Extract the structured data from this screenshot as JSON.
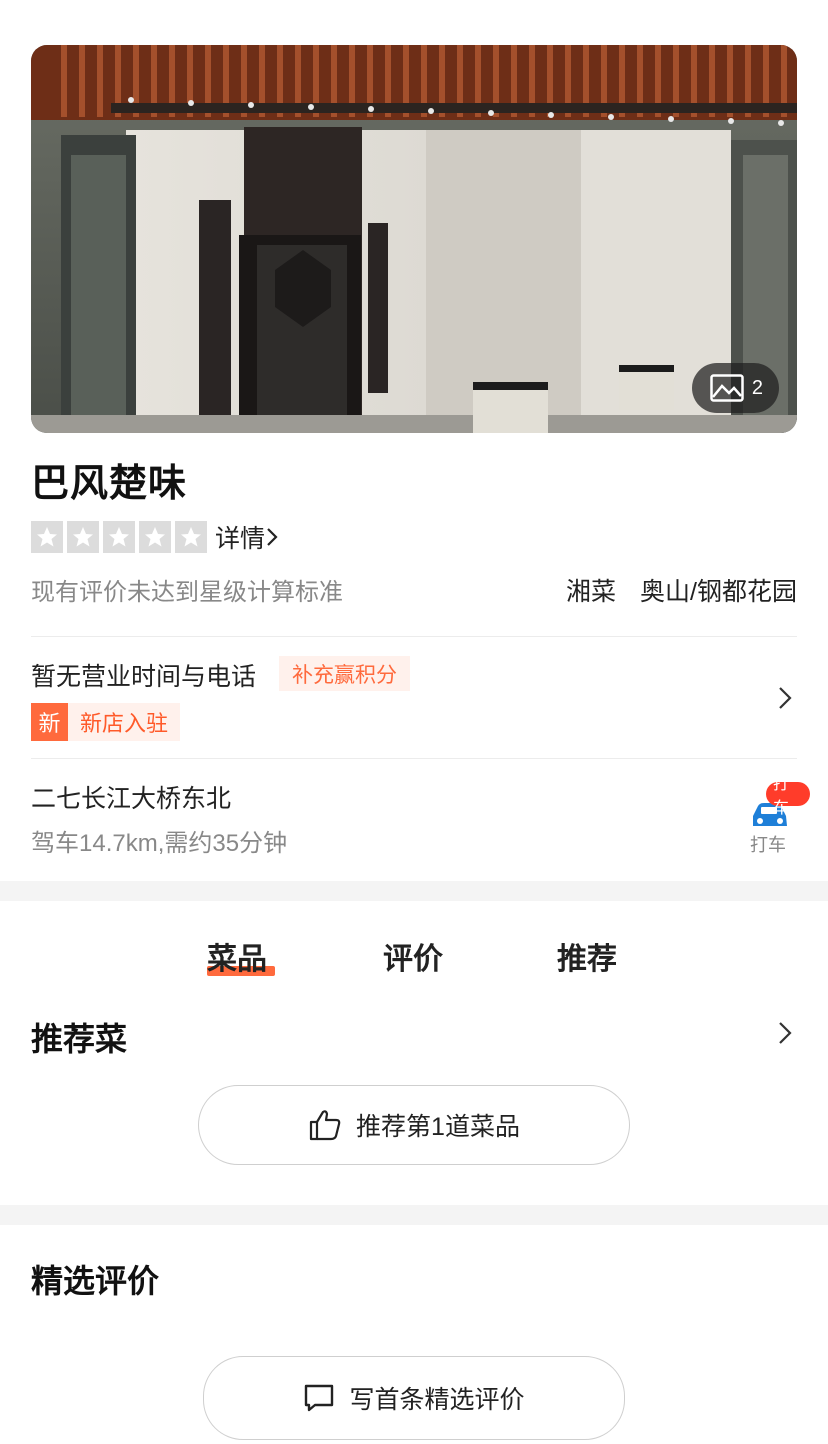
{
  "hero": {
    "photo_count": "2"
  },
  "shop": {
    "name": "巴风楚味",
    "detail_link": "详情",
    "rating_note": "现有评价未达到星级计算标准",
    "tags": [
      "湘菜",
      "奥山/钢都花园"
    ],
    "rating_stars": 0
  },
  "hours": {
    "text": "暂无营业时间与电话",
    "points_badge": "补充赢积分",
    "new_mark": "新",
    "new_label": "新店入驻"
  },
  "address": {
    "text": "二七长江大桥东北",
    "drive_info": "驾车14.7km,需约35分钟",
    "taxi_badge": "打车",
    "taxi_label": "打车"
  },
  "tabs": [
    {
      "label": "菜品",
      "active": true
    },
    {
      "label": "评价",
      "active": false
    },
    {
      "label": "推荐",
      "active": false
    }
  ],
  "recommend": {
    "title": "推荐菜",
    "button_label": "推荐第1道菜品"
  },
  "reviews": {
    "title": "精选评价",
    "button_label": "写首条精选评价"
  },
  "colors": {
    "accent": "#ff6a3d",
    "badge_bg": "#fff1ec",
    "taxi_blue": "#1e7fd8",
    "taxi_badge": "#ff3c2a"
  }
}
